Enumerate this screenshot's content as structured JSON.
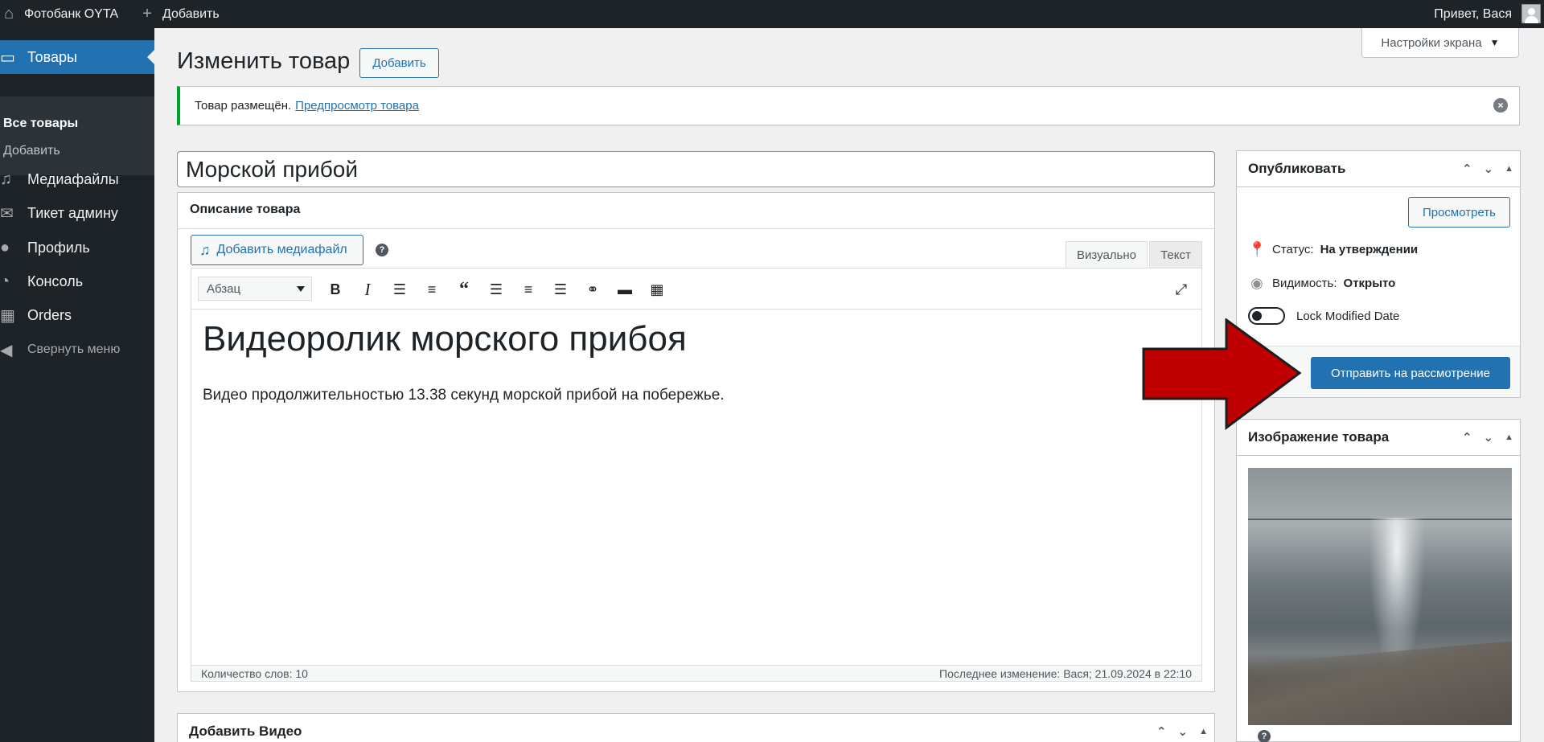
{
  "adminbar": {
    "site_name": "Фотобанк OYTA",
    "add_label": "Добавить",
    "greeting": "Привет, Вася"
  },
  "sidebar": {
    "items": [
      {
        "label": "Товары",
        "icon": "archive-icon"
      },
      {
        "label": "Медиафайлы",
        "icon": "media-icon"
      },
      {
        "label": "Тикет админу",
        "icon": "envelope-icon"
      },
      {
        "label": "Профиль",
        "icon": "user-icon"
      },
      {
        "label": "Консоль",
        "icon": "dashboard-icon"
      },
      {
        "label": "Orders",
        "icon": "store-icon"
      }
    ],
    "submenu": [
      "Все товары",
      "Добавить"
    ],
    "collapse_label": "Свернуть меню"
  },
  "header": {
    "title": "Изменить товар",
    "add_button": "Добавить",
    "screen_options": "Настройки экрана"
  },
  "notice": {
    "text": "Товар размещён.",
    "link": "Предпросмотр товара"
  },
  "post": {
    "title": "Морской прибой"
  },
  "editor": {
    "section_label": "Описание товара",
    "add_media": "Добавить медиафайл",
    "tab_visual": "Визуально",
    "tab_text": "Текст",
    "format": "Абзац",
    "heading": "Видеоролик морского прибоя",
    "paragraph": "Видео продолжительностью 13.38 секунд морской прибой на побережье.",
    "word_count": "Количество слов: 10",
    "last_modified": "Последнее изменение: Вася; 21.09.2024 в 22:10"
  },
  "publish": {
    "title": "Опубликовать",
    "preview_button": "Просмотреть",
    "status_label": "Статус:",
    "status_value": "На утверждении",
    "visibility_label": "Видимость:",
    "visibility_value": "Открыто",
    "lock_label": "Lock Modified Date",
    "submit_button": "Отправить на рассмотрение"
  },
  "image_box": {
    "title": "Изображение товара"
  },
  "video_box": {
    "title": "Добавить Видео"
  },
  "colors": {
    "accent": "#2271b1",
    "admin_bg": "#1d2327",
    "notice_success": "#00a32a",
    "arrow": "#c00000"
  }
}
